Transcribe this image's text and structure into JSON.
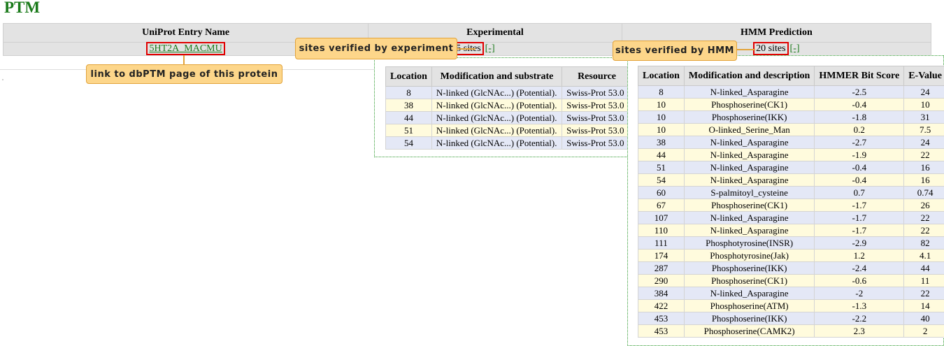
{
  "page_title": "PTM",
  "main": {
    "headers": [
      "UniProt Entry Name",
      "Experimental",
      "HMM Prediction"
    ],
    "entry_name": "5HT2A_MACMU",
    "experimental_sites": "5 sites",
    "hmm_sites": "20 sites",
    "toggle_label": "[-]"
  },
  "callouts": {
    "entry": "link to dbPTM page of this protein",
    "experimental": "sites verified by experiment",
    "hmm": "sites verified by HMM"
  },
  "experimental_popup": {
    "headers": [
      "Location",
      "Modification and substrate",
      "Resource"
    ],
    "rows": [
      [
        "8",
        "N-linked (GlcNAc...) (Potential).",
        "Swiss-Prot 53.0"
      ],
      [
        "38",
        "N-linked (GlcNAc...) (Potential).",
        "Swiss-Prot 53.0"
      ],
      [
        "44",
        "N-linked (GlcNAc...) (Potential).",
        "Swiss-Prot 53.0"
      ],
      [
        "51",
        "N-linked (GlcNAc...) (Potential).",
        "Swiss-Prot 53.0"
      ],
      [
        "54",
        "N-linked (GlcNAc...) (Potential).",
        "Swiss-Prot 53.0"
      ]
    ]
  },
  "hmm_popup": {
    "headers": [
      "Location",
      "Modification and description",
      "HMMER Bit Score",
      "E-Value"
    ],
    "rows": [
      [
        "8",
        "N-linked_Asparagine",
        "-2.5",
        "24"
      ],
      [
        "10",
        "Phosphoserine(CK1)",
        "-0.4",
        "10"
      ],
      [
        "10",
        "Phosphoserine(IKK)",
        "-1.8",
        "31"
      ],
      [
        "10",
        "O-linked_Serine_Man",
        "0.2",
        "7.5"
      ],
      [
        "38",
        "N-linked_Asparagine",
        "-2.7",
        "24"
      ],
      [
        "44",
        "N-linked_Asparagine",
        "-1.9",
        "22"
      ],
      [
        "51",
        "N-linked_Asparagine",
        "-0.4",
        "16"
      ],
      [
        "54",
        "N-linked_Asparagine",
        "-0.4",
        "16"
      ],
      [
        "60",
        "S-palmitoyl_cysteine",
        "0.7",
        "0.74"
      ],
      [
        "67",
        "Phosphoserine(CK1)",
        "-1.7",
        "26"
      ],
      [
        "107",
        "N-linked_Asparagine",
        "-1.7",
        "22"
      ],
      [
        "110",
        "N-linked_Asparagine",
        "-1.7",
        "22"
      ],
      [
        "111",
        "Phosphotyrosine(INSR)",
        "-2.9",
        "82"
      ],
      [
        "174",
        "Phosphotyrosine(Jak)",
        "1.2",
        "4.1"
      ],
      [
        "287",
        "Phosphoserine(IKK)",
        "-2.4",
        "44"
      ],
      [
        "290",
        "Phosphoserine(CK1)",
        "-0.6",
        "11"
      ],
      [
        "384",
        "N-linked_Asparagine",
        "-2",
        "22"
      ],
      [
        "422",
        "Phosphoserine(ATM)",
        "-1.3",
        "14"
      ],
      [
        "453",
        "Phosphoserine(IKK)",
        "-2.2",
        "40"
      ],
      [
        "453",
        "Phosphoserine(CAMK2)",
        "2.3",
        "2"
      ]
    ]
  },
  "colors": {
    "title_green": "#1a7a1a",
    "header_gray": "#e3e3e3",
    "row_blue": "#e4e8f6",
    "row_yellow": "#fffbdd",
    "callout_fill": "#fdd68a",
    "highlight_red": "#e00000"
  }
}
